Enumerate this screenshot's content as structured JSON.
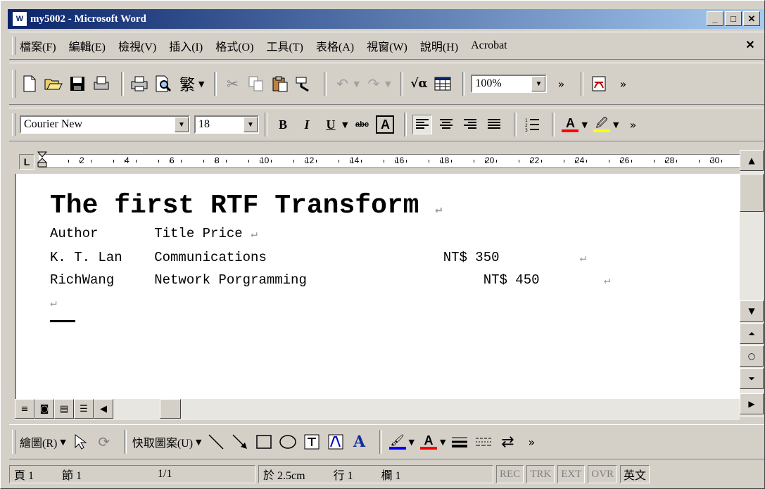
{
  "window": {
    "title": "my5002 - Microsoft Word",
    "app_icon": "W",
    "controls": [
      "_",
      "□",
      "✕"
    ]
  },
  "menu": {
    "items": [
      "檔案(F)",
      "編輯(E)",
      "檢視(V)",
      "插入(I)",
      "格式(O)",
      "工具(T)",
      "表格(A)",
      "視窗(W)",
      "說明(H)",
      "Acrobat"
    ],
    "close": "✕"
  },
  "toolbar": {
    "traditional_label": "繁",
    "zoom": "100%"
  },
  "format": {
    "font": "Courier New",
    "size": "18",
    "bold": "B",
    "italic": "I",
    "underline": "U",
    "strike": "abc",
    "boxed": "A",
    "font_color": "A",
    "highlight": "🖉"
  },
  "ruler": {
    "numbers": [
      "2",
      "4",
      "6",
      "8",
      "10",
      "12",
      "14",
      "16",
      "18",
      "20",
      "22",
      "24",
      "26",
      "28",
      "30"
    ]
  },
  "document": {
    "heading": "The first RTF Transform",
    "lines": [
      "Author       Title Price",
      "K. T. Lan    Communications                      NT$ 350",
      "RichWang     Network Porgramming                      NT$ 450"
    ],
    "mark": "↵"
  },
  "drawing": {
    "draw_label": "繪圖(R)",
    "autoshape_label": "快取圖案(U)"
  },
  "status": {
    "page": "頁 1",
    "section": "節 1",
    "pages": "1/1",
    "at": "於 2.5cm",
    "line": "行 1",
    "col": "欄 1",
    "rec": "REC",
    "trk": "TRK",
    "ext": "EXT",
    "ovr": "OVR",
    "lang": "英文"
  }
}
